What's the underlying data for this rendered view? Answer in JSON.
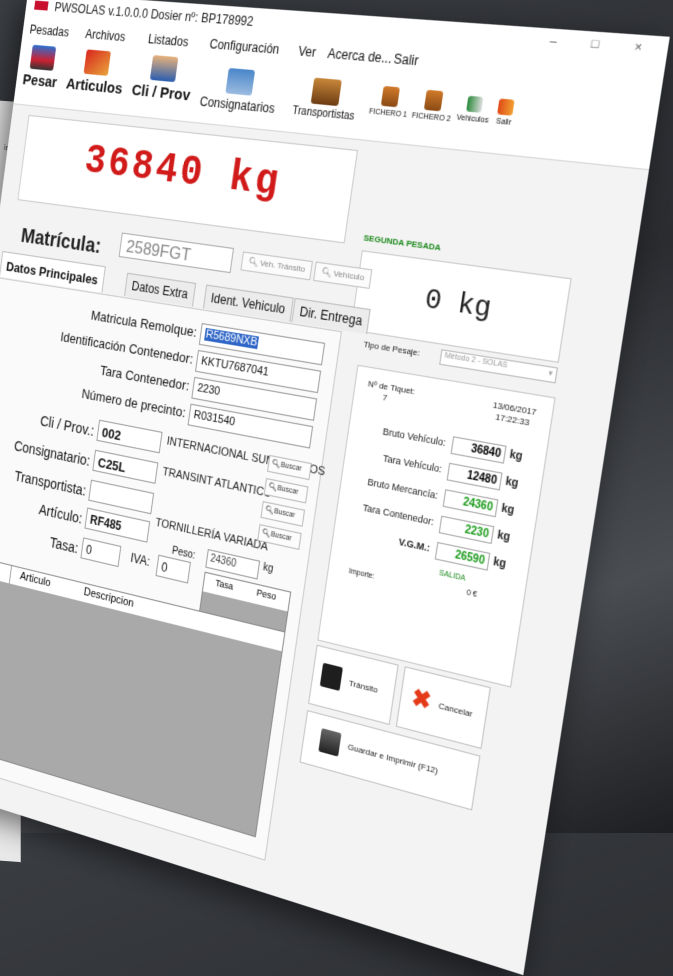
{
  "app": {
    "title": "PWSOLAS v.1.0.0.0 Dosier nº: BP178992"
  },
  "window_controls": "– □ ×",
  "menu": [
    "Pesadas",
    "Archivos",
    "Listados",
    "Configuración",
    "Ver",
    "Acerca de...",
    "Salir"
  ],
  "toolbar": {
    "pesar": "Pesar",
    "articulos": "Articulos",
    "cli_prov": "Cli / Prov",
    "consignatarios": "Consignatarios",
    "transportistas": "Transportistas",
    "fichero1": "FICHERO 1",
    "fichero2": "FICHERO 2",
    "vehiculos": "Vehiculos",
    "salir": "Salir"
  },
  "weight": {
    "primary": "36840 kg",
    "secondary": "0 kg",
    "status": "SEGUNDA PESADA"
  },
  "matricula": {
    "label": "Matrícula:",
    "value": "2589FGT"
  },
  "buttons": {
    "veh_transito": "Veh. Tránsito",
    "vehiculo": "Vehículo",
    "buscar": "Buscar"
  },
  "tabs": [
    "Datos Principales",
    "Datos Extra",
    "Ident. Vehiculo",
    "Dir. Entrega"
  ],
  "form": {
    "matricula_remolque": {
      "label": "Matricula Remolque:",
      "value": "R5689NXB"
    },
    "contenedor": {
      "label": "Identificación Contenedor:",
      "value": "KKTU7687041"
    },
    "tara_contenedor": {
      "label": "Tara Contenedor:",
      "value": "2230"
    },
    "precinto": {
      "label": "Número de precinto:",
      "value": "R031540"
    },
    "cli_prov": {
      "label": "Cli / Prov.:",
      "code": "002",
      "name": "INTERNACIONAL SUMINISTROS"
    },
    "consignatario": {
      "label": "Consignatario:",
      "code": "C25L",
      "name": "TRANSINT ATLANTICO"
    },
    "transportista": {
      "label": "Transportista:",
      "code": ""
    },
    "articulo": {
      "label": "Artículo:",
      "code": "RF485",
      "name": "TORNILLERÍA VARIADA"
    },
    "peso": {
      "label": "Peso:",
      "value": "24360",
      "unit": "kg"
    },
    "tasa": {
      "label": "Tasa:",
      "value": "0"
    },
    "iva": {
      "label": "IVA:",
      "value": "0"
    }
  },
  "grid_small": {
    "headers": [
      "Tasa",
      "Peso"
    ]
  },
  "grid_main": {
    "headers": [
      "Articulo",
      "Descripcion"
    ]
  },
  "tipo_pesaje": {
    "label": "Tipo de Pesaje:",
    "value": "Método 2 - SOLAS"
  },
  "ticket": {
    "label": "Nº de Tiquet:",
    "number": "7",
    "date": "13/06/2017",
    "time": "17:22:33"
  },
  "summary": {
    "bruto_vehiculo": {
      "label": "Bruto Vehículo:",
      "value": "36840"
    },
    "tara_vehiculo": {
      "label": "Tara Vehículo:",
      "value": "12480"
    },
    "bruto_mercancia": {
      "label": "Bruto Mercancía:",
      "value": "24360"
    },
    "tara_contenedor": {
      "label": "Tara Contenedor:",
      "value": "2230"
    },
    "vgm": {
      "label": "V.G.M.:",
      "value": "26590"
    },
    "unit": "kg",
    "salida": "SALIDA",
    "importe": {
      "label": "Importe:",
      "value": "0 €"
    }
  },
  "actions": {
    "transito": "Tránsito",
    "cancelar": "Cancelar",
    "guardar": "Guardar e Imprimir (F12)"
  },
  "colors": {
    "weight_red": "#d11a1a",
    "status_green": "#1c8a1c",
    "selection_blue": "#2f66c7",
    "brand_red": "#c8102e"
  }
}
